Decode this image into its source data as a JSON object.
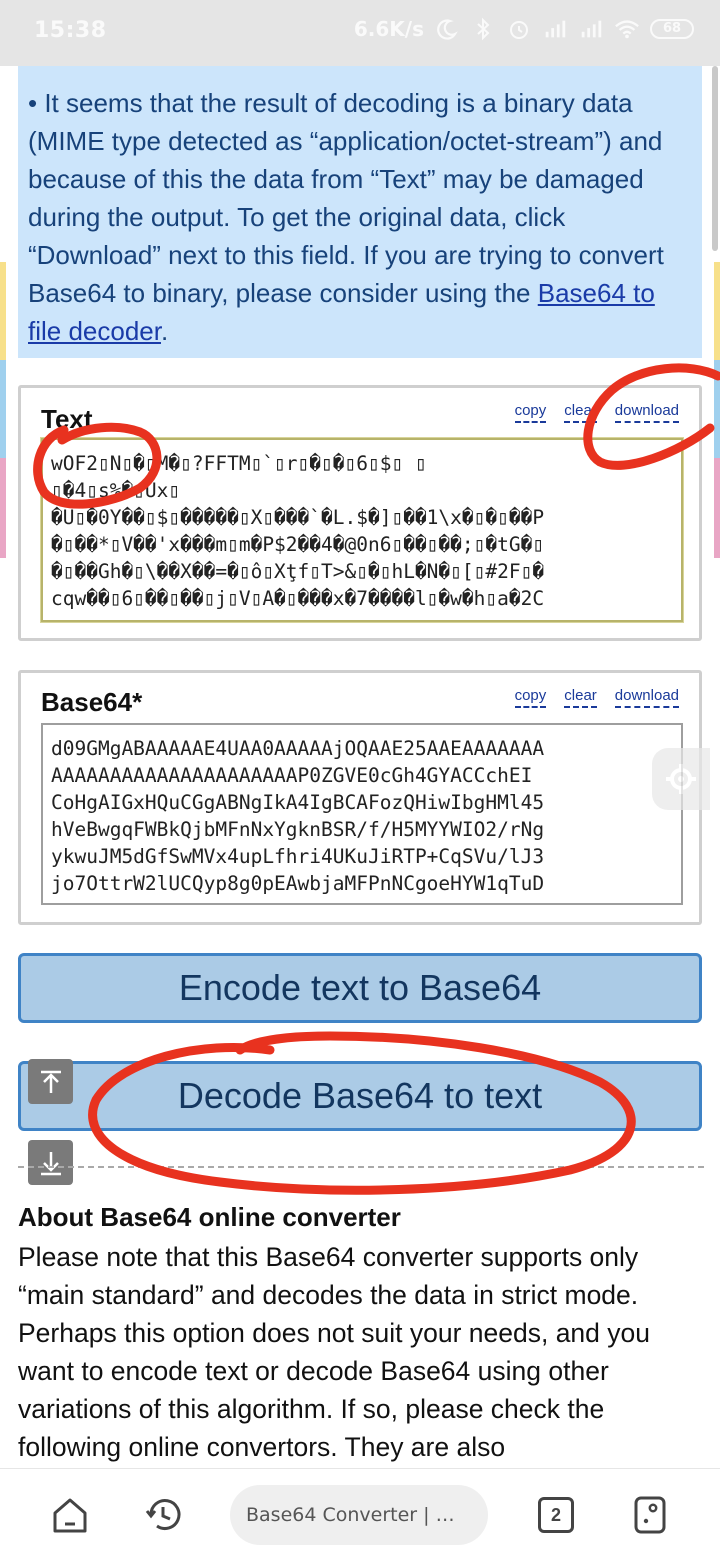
{
  "status_bar": {
    "time": "15:38",
    "net_speed": "6.6K/s",
    "battery": "68",
    "icons": [
      "moon-icon",
      "bluetooth-icon",
      "alarm-icon",
      "signal-hd-icon",
      "signal-hd-icon",
      "wifi-icon",
      "battery-icon"
    ]
  },
  "notice": {
    "text": "• It seems that the result of decoding is a binary data (MIME type detected as “application/octet-stream”) and because of this the data from “Text” may be damaged during the output. To get the original data, click “Download” next to this field. If you are trying to convert Base64 to binary, please consider using the ",
    "link": "Base64 to file decoder",
    "after": "."
  },
  "text_panel": {
    "title": "Text",
    "copy": "copy",
    "clear": "clear",
    "download": "download",
    "value": "wOF2▯N▯�▯M�▯?FFTM▯`▯r▯�▯�▯6▯$▯ ▯\n▯�4▯s%�▯Ux▯\n�U▯�0Y��▯$▯�����▯X▯���`�L.$�]▯��1\\x�▯�▯��P\n�▯��*▯V��'x���m▯m�P$2��4�@0n6▯��▯��;▯�tG�▯\n�▯��Gh�▯\\��X��=�▯ô▯Xţf▯T>&▯�▯hL�N�▯[▯#2F▯�\ncqw��▯6▯��▯��▯j▯V▯A�▯���x�7����l▯�w�h▯a�2C"
  },
  "base64_panel": {
    "title": "Base64*",
    "copy": "copy",
    "clear": "clear",
    "download": "download",
    "value": "d09GMgABAAAAAE4UAA0AAAAAjOQAAE25AAEAAAAAAA\nAAAAAAAAAAAAAAAAAAAAAP0ZGVE0cGh4GYACCchEI\nCoHgAIGxHQuCGgABNgIkA4IgBCAFozQHiwIbgHMl45\nhVeBwgqFWBkQjbMFnNxYgknBSR/f/H5MYYWIO2/rNg\nykwuJM5dGfSwMVx4upLfhri4UKuJiRTP+CqSVu/lJ3\njo7OttrW2lUCQyp8g0pEAwbjaMFPnNCgoeHYW1qTuD"
  },
  "buttons": {
    "encode": "Encode text to Base64",
    "decode": "Decode Base64 to text"
  },
  "about": {
    "title": "About Base64 online converter",
    "body": "Please note that this Base64 converter supports only “main standard” and decodes the data in strict mode. Perhaps this option does not suit your needs, and you want to encode text or decode Base64 using other variations of this algorithm. If so, please check the following online convertors. They are also"
  },
  "bottom_nav": {
    "url_text": "Base64 Converter | …",
    "tab_count": "2"
  },
  "colors": {
    "annotation": "#e8321f",
    "button_fill": "#abcbe6",
    "button_border": "#3f83c6",
    "notice_bg": "#cce5fb"
  }
}
